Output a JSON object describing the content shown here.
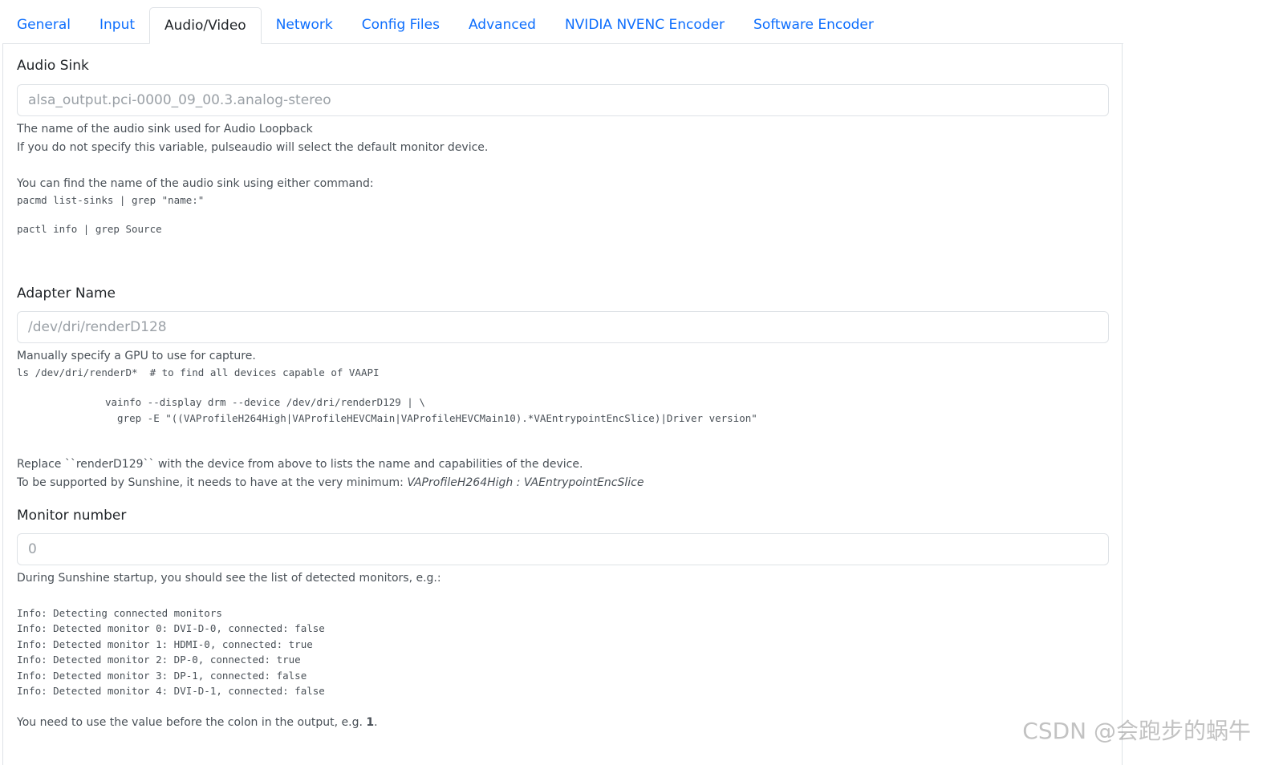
{
  "tabs": [
    "General",
    "Input",
    "Audio/Video",
    "Network",
    "Config Files",
    "Advanced",
    "NVIDIA NVENC Encoder",
    "Software Encoder"
  ],
  "active_tab": "Audio/Video",
  "audio_sink": {
    "label": "Audio Sink",
    "placeholder": "alsa_output.pci-0000_09_00.3.analog-stereo",
    "desc1": "The name of the audio sink used for Audio Loopback",
    "desc2": "If you do not specify this variable, pulseaudio will select the default monitor device.",
    "desc3": "You can find the name of the audio sink using either command:",
    "cmd1": "pacmd list-sinks | grep \"name:\"",
    "cmd2": "pactl info | grep Source"
  },
  "adapter": {
    "label": "Adapter Name",
    "placeholder": "/dev/dri/renderD128",
    "desc1": "Manually specify a GPU to use for capture.",
    "cmd1": "ls /dev/dri/renderD*  # to find all devices capable of VAAPI",
    "cmd2": "vainfo --display drm --device /dev/dri/renderD129 | \\",
    "cmd3": "  grep -E \"((VAProfileH264High|VAProfileHEVCMain|VAProfileHEVCMain10).*VAEntrypointEncSlice)|Driver version\"",
    "desc2": "Replace ``renderD129`` with the device from above to lists the name and capabilities of the device.",
    "desc3_prefix": "To be supported by Sunshine, it needs to have at the very minimum: ",
    "desc3_em": "VAProfileH264High : VAEntrypointEncSlice"
  },
  "monitor": {
    "label": "Monitor number",
    "placeholder": "0",
    "desc1": "During Sunshine startup, you should see the list of detected monitors, e.g.:",
    "log": [
      "Info: Detecting connected monitors",
      "Info: Detected monitor 0: DVI-D-0, connected: false",
      "Info: Detected monitor 1: HDMI-0, connected: true",
      "Info: Detected monitor 2: DP-0, connected: true",
      "Info: Detected monitor 3: DP-1, connected: false",
      "Info: Detected monitor 4: DVI-D-1, connected: false"
    ],
    "desc2_prefix": "You need to use the value before the colon in the output, e.g. ",
    "desc2_bold": "1",
    "desc2_suffix": "."
  },
  "watermark": "CSDN @会跑步的蜗牛"
}
